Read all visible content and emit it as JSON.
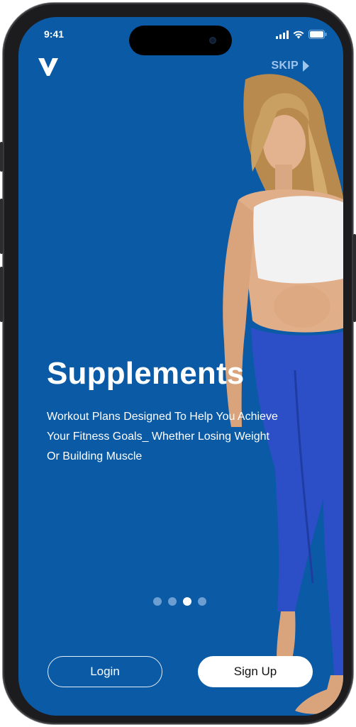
{
  "status_bar": {
    "time": "9:41"
  },
  "header": {
    "skip_label": "SKIP"
  },
  "onboarding": {
    "title": "Supplements",
    "subtitle_lines": [
      "Workout Plans Designed To Help You Achieve",
      "Your Fitness Goals_ Whether Losing Weight",
      "Or Building Muscle"
    ],
    "page_count": 4,
    "active_page_index": 2
  },
  "actions": {
    "login_label": "Login",
    "signup_label": "Sign Up"
  },
  "colors": {
    "background": "#0a5aa6",
    "dot_inactive": "#6c9ed2",
    "dot_active": "#ffffff"
  },
  "icons": [
    "brand-logo-icon",
    "skip-arrow-icon",
    "signal-icon",
    "wifi-icon",
    "battery-icon"
  ]
}
